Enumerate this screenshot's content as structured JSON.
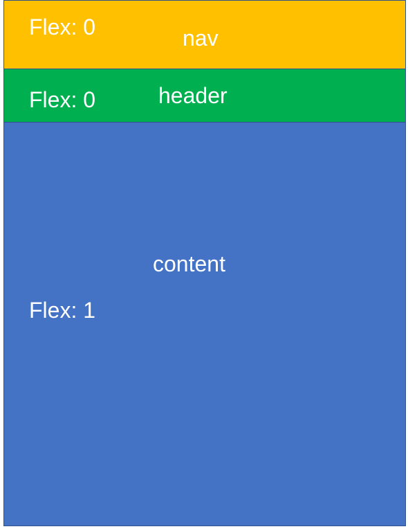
{
  "diagram": {
    "blocks": [
      {
        "id": "nav",
        "name": "nav",
        "flex_label": "Flex: 0",
        "color": "#ffc000"
      },
      {
        "id": "header",
        "name": "header",
        "flex_label": "Flex: 0",
        "color": "#00b050"
      },
      {
        "id": "content",
        "name": "content",
        "flex_label": "Flex: 1",
        "color": "#4472c4"
      }
    ],
    "border_color": "#2f528f"
  }
}
